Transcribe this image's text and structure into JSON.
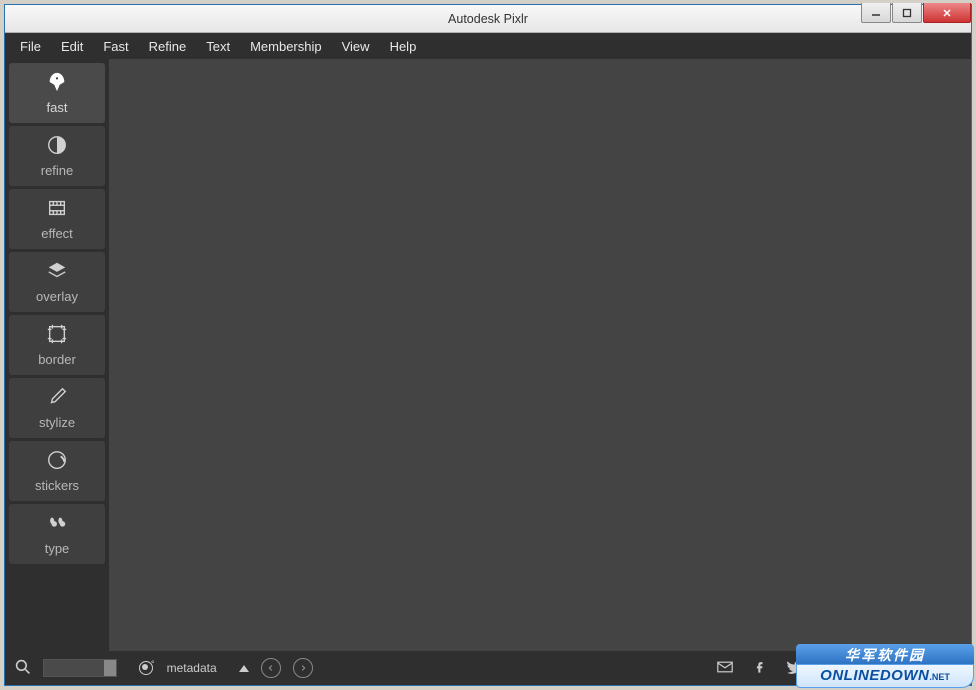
{
  "window": {
    "title": "Autodesk Pixlr"
  },
  "menu": {
    "items": [
      "File",
      "Edit",
      "Fast",
      "Refine",
      "Text",
      "Membership",
      "View",
      "Help"
    ]
  },
  "sidebar": {
    "tools": [
      {
        "id": "fast",
        "label": "fast",
        "icon": "rocket-icon"
      },
      {
        "id": "refine",
        "label": "refine",
        "icon": "contrast-icon"
      },
      {
        "id": "effect",
        "label": "effect",
        "icon": "film-icon"
      },
      {
        "id": "overlay",
        "label": "overlay",
        "icon": "layers-icon"
      },
      {
        "id": "border",
        "label": "border",
        "icon": "frame-icon"
      },
      {
        "id": "stylize",
        "label": "stylize",
        "icon": "brush-icon"
      },
      {
        "id": "stickers",
        "label": "stickers",
        "icon": "sticker-icon"
      },
      {
        "id": "type",
        "label": "type",
        "icon": "quote-icon"
      }
    ]
  },
  "statusbar": {
    "metadata_label": "metadata"
  },
  "watermark": {
    "line1": "华军软件园",
    "line2": "ONLINEDOWN",
    "suffix": ".NET"
  }
}
